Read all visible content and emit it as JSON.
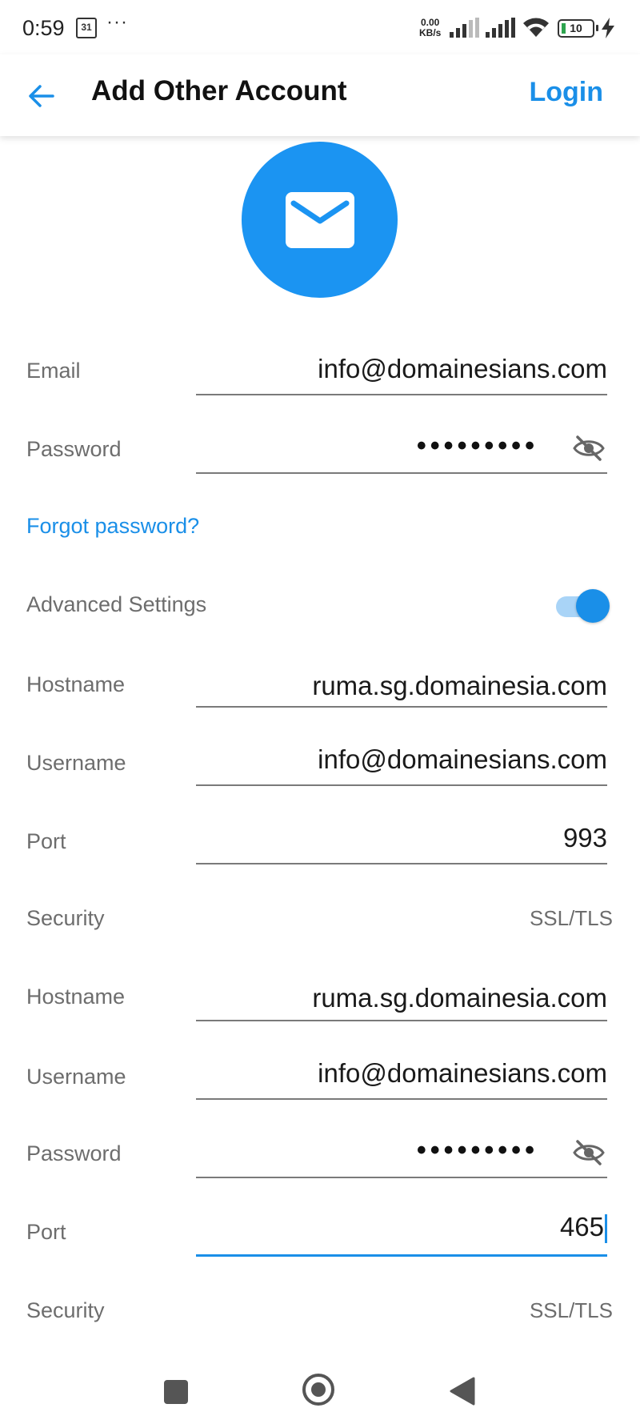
{
  "status_bar": {
    "time": "0:59",
    "calendar_day": "31",
    "more": "···",
    "net_speed_value": "0.00",
    "net_speed_unit": "KB/s",
    "battery_percent": "10"
  },
  "app_bar": {
    "title": "Add Other Account",
    "login_label": "Login"
  },
  "form": {
    "email_label": "Email",
    "email_value": "info@domainesians.com",
    "password_label": "Password",
    "password_mask": "•••••••••",
    "forgot_password": "Forgot password?",
    "advanced_label": "Advanced Settings",
    "advanced_enabled": true
  },
  "incoming": {
    "hostname_label": "Hostname",
    "hostname_value": "ruma.sg.domainesia.com",
    "username_label": "Username",
    "username_value": "info@domainesians.com",
    "port_label": "Port",
    "port_value": "993",
    "security_label": "Security",
    "security_value": "SSL/TLS"
  },
  "outgoing": {
    "hostname_label": "Hostname",
    "hostname_value": "ruma.sg.domainesia.com",
    "username_label": "Username",
    "username_value": "info@domainesians.com",
    "password_label": "Password",
    "password_mask": "•••••••••",
    "port_label": "Port",
    "port_value": "465",
    "security_label": "Security",
    "security_value": "SSL/TLS"
  },
  "colors": {
    "accent": "#1a8fe8",
    "avatar": "#1b94f2",
    "label": "#6d6d6d"
  },
  "icons": {
    "back": "arrow-left-icon",
    "avatar": "mail-envelope-icon",
    "password_visibility": "eye-off-icon"
  }
}
